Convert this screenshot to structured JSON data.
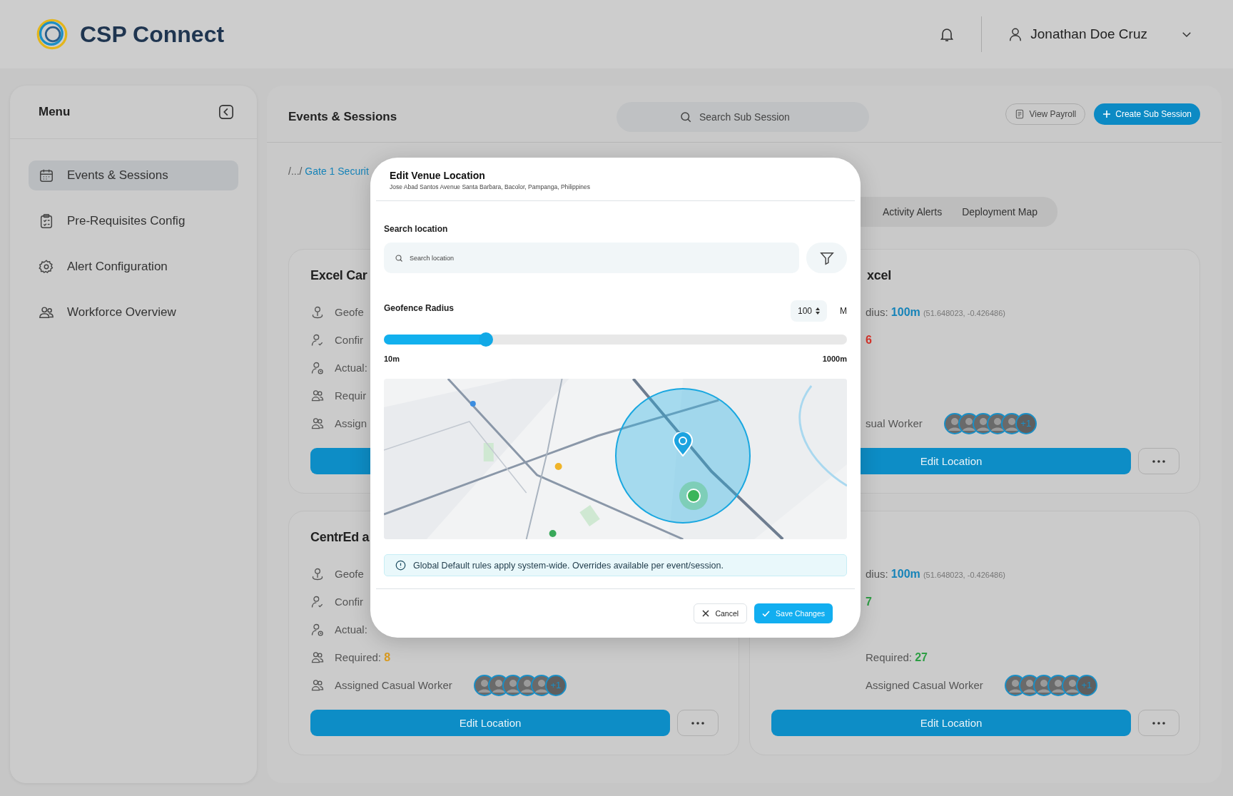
{
  "app": {
    "name": "CSP Connect"
  },
  "user": {
    "name": "Jonathan Doe Cruz"
  },
  "sidebar": {
    "title": "Menu",
    "items": [
      {
        "label": "Events & Sessions",
        "kind": "calendar",
        "selected": true
      },
      {
        "label": "Pre-Requisites Config",
        "kind": "clipboard",
        "selected": false
      },
      {
        "label": "Alert Configuration",
        "kind": "gear",
        "selected": false
      },
      {
        "label": "Workforce Overview",
        "kind": "people",
        "selected": false
      }
    ]
  },
  "main": {
    "title": "Events & Sessions",
    "search": {
      "placeholder": "Search Sub Session"
    },
    "buttons": [
      {
        "label": "View Payroll",
        "kind": "secondary"
      },
      {
        "label": "Create Sub Session",
        "kind": "primary"
      }
    ],
    "breadcrumb": {
      "prefix": "/.../",
      "current": "Gate 1 Securit"
    },
    "tabs": [
      {
        "label": "Activity Alerts",
        "selected": false
      },
      {
        "label": "Deployment Map",
        "selected": false
      }
    ],
    "cards": [
      {
        "title": "Excel Car",
        "rows": [
          {
            "kind": "geofence",
            "label": "Geofe"
          },
          {
            "kind": "confirmed",
            "label": "Confir"
          },
          {
            "kind": "actual",
            "label": "Actual:"
          },
          {
            "kind": "required",
            "label": "Requir"
          },
          {
            "kind": "assigned",
            "label": "Assign"
          }
        ],
        "edit_button": true
      },
      {
        "title": "xcel",
        "rows": [
          {
            "kind": "geofence",
            "label": "dius:",
            "value": "100m",
            "coords": "(51.648023, -0.426486)"
          },
          {
            "kind": "confirmed",
            "value": "6",
            "color": "#d9342b"
          },
          {
            "kind": "actual"
          },
          {
            "kind": "required"
          },
          {
            "kind": "assigned",
            "label": "sual Worker",
            "more": "+1"
          }
        ],
        "edit_button": true,
        "button": "Edit Location",
        "more": true
      },
      {
        "title": "CentrEd a",
        "rows": [
          {
            "kind": "geofence",
            "label": "Geofe"
          },
          {
            "kind": "confirmed",
            "label": "Confir"
          },
          {
            "kind": "actual",
            "label": "Actual:"
          },
          {
            "kind": "required",
            "label": "Required:",
            "value": "8",
            "color": "#d99a1e"
          },
          {
            "kind": "assigned",
            "label": "Assigned Casual Worker",
            "more": "+1"
          }
        ],
        "edit_button": true,
        "button": "Edit Location",
        "more": true
      },
      {
        "rows": [
          {
            "kind": "geofence",
            "label": "dius:",
            "value": "100m",
            "coords": "(51.648023, -0.426486)"
          },
          {
            "kind": "confirmed",
            "value": "7",
            "color": "#2e9e45"
          },
          {
            "kind": "actual"
          },
          {
            "kind": "required",
            "label": "Required:",
            "value": "27",
            "color": "#2e9e45"
          },
          {
            "kind": "assigned",
            "label": "Assigned Casual Worker",
            "more": "+1"
          }
        ],
        "edit_button": true,
        "button": "Edit Location",
        "more": true
      }
    ]
  },
  "modal": {
    "title": "Edit Venue Location",
    "subtitle": "Jose Abad Santos Avenue Santa Barbara, Bacolor, Pampanga, Philippines",
    "search_label": "Search location",
    "search": {
      "placeholder": "Search location"
    },
    "radius_label": "Geofence Radius",
    "radius_value": "100",
    "unit": "M",
    "slider": {
      "level": 0.22,
      "min_label": "10m",
      "max_label": "1000m"
    },
    "info": "Global Default rules apply system-wide. Overrides available per event/session.",
    "buttons": [
      {
        "label": "Cancel",
        "kind": "cancel"
      },
      {
        "label": "Save Changes",
        "kind": "save"
      }
    ]
  }
}
